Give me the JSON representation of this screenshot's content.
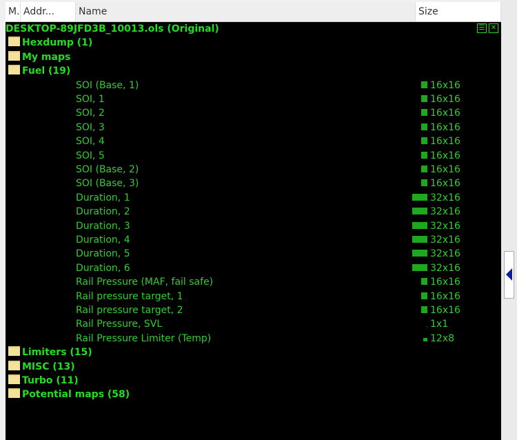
{
  "header": {
    "columns": [
      "M.",
      "Addr...",
      "Name",
      "Size"
    ]
  },
  "root": "DESKTOP-89JFD3B_10013.ols (Original)",
  "folders_top": [
    "Hexdump (1)",
    "My maps",
    "Fuel (19)"
  ],
  "fuel_items": [
    {
      "name": "SOI (Base, 1)",
      "size": "16x16"
    },
    {
      "name": "SOI, 1",
      "size": "16x16"
    },
    {
      "name": "SOI, 2",
      "size": "16x16"
    },
    {
      "name": "SOI, 3",
      "size": "16x16"
    },
    {
      "name": "SOI, 4",
      "size": "16x16"
    },
    {
      "name": "SOI, 5",
      "size": "16x16"
    },
    {
      "name": "SOI (Base, 2)",
      "size": "16x16"
    },
    {
      "name": "SOI (Base, 3)",
      "size": "16x16"
    },
    {
      "name": "Duration, 1",
      "size": "32x16"
    },
    {
      "name": "Duration, 2",
      "size": "32x16"
    },
    {
      "name": "Duration, 3",
      "size": "32x16"
    },
    {
      "name": "Duration, 4",
      "size": "32x16"
    },
    {
      "name": "Duration, 5",
      "size": "32x16"
    },
    {
      "name": "Duration, 6",
      "size": "32x16"
    },
    {
      "name": "Rail Pressure (MAF, fail safe)",
      "size": "16x16"
    },
    {
      "name": "Rail pressure target, 1",
      "size": "16x16"
    },
    {
      "name": "Rail pressure target, 2",
      "size": "16x16"
    },
    {
      "name": "Rail Pressure, SVL",
      "size": "1x1"
    },
    {
      "name": "Rail Pressure Limiter (Temp)",
      "size": "12x8"
    }
  ],
  "folders_bottom": [
    "Limiters (15)",
    "MISC (13)",
    "Turbo (11)",
    "Potential maps (58)"
  ],
  "colors": {
    "text": "#22dd22",
    "background": "#000000"
  }
}
